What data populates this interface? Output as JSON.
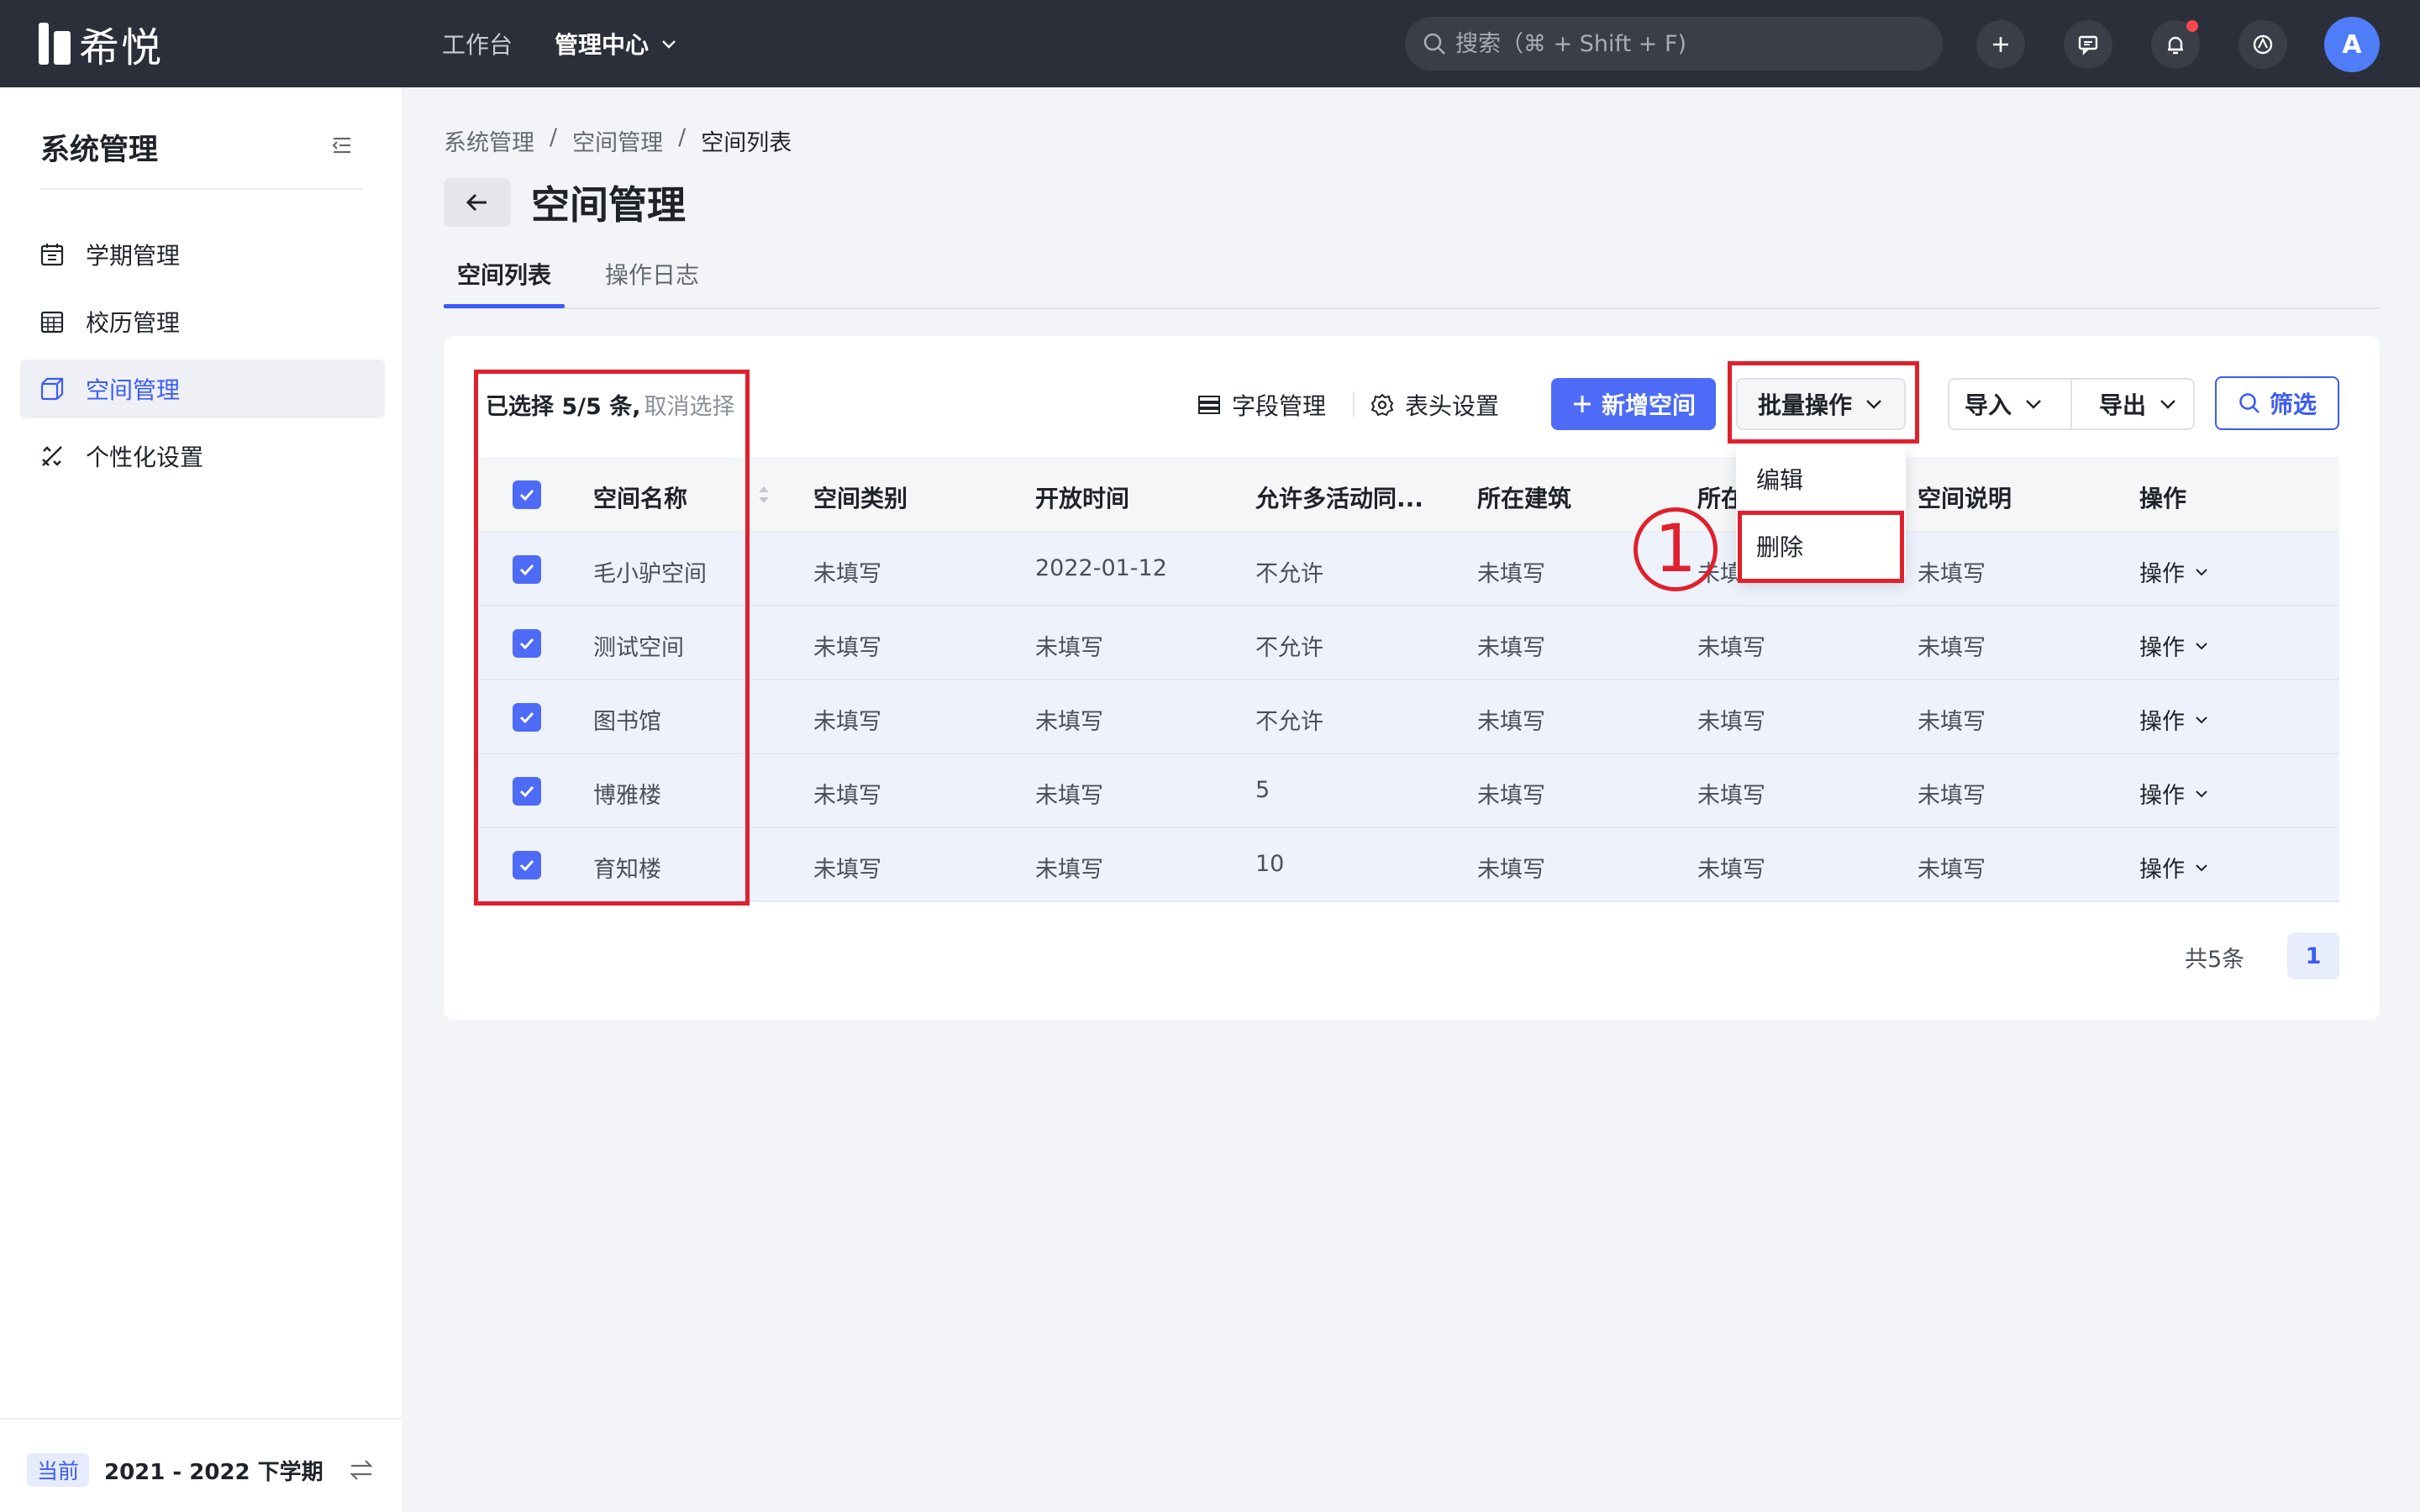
{
  "app": {
    "logo_text": "希悦",
    "nav": [
      "工作台",
      "管理中心"
    ],
    "search_placeholder": "搜索（⌘ + Shift + F)",
    "avatar_letter": "A"
  },
  "sidebar": {
    "title": "系统管理",
    "items": [
      {
        "label": "学期管理",
        "icon": "calendar-icon"
      },
      {
        "label": "校历管理",
        "icon": "school-calendar-icon"
      },
      {
        "label": "空间管理",
        "icon": "cube-icon",
        "active": true
      },
      {
        "label": "个性化设置",
        "icon": "tools-icon"
      }
    ],
    "footer": {
      "badge": "当前",
      "term": "2021 - 2022 下学期"
    }
  },
  "header": {
    "breadcrumb": [
      "系统管理",
      "空间管理",
      "空间列表"
    ],
    "title": "空间管理",
    "tabs": [
      "空间列表",
      "操作日志"
    ]
  },
  "toolbar": {
    "selection_text": "已选择 5/5 条,",
    "cancel_selection": "取消选择",
    "field_manage": "字段管理",
    "header_settings": "表头设置",
    "add_space": "新增空间",
    "batch_ops": "批量操作",
    "import": "导入",
    "export": "导出",
    "filter": "筛选"
  },
  "batch_menu": [
    "编辑",
    "删除"
  ],
  "table": {
    "columns": [
      "空间名称",
      "空间类别",
      "开放时间",
      "允许多活动同...",
      "所在建筑",
      "所在",
      "空间说明",
      "操作"
    ],
    "rows": [
      [
        "毛小驴空间",
        "未填写",
        "2022-01-12",
        "不允许",
        "未填写",
        "未填写",
        "未填写",
        "操作"
      ],
      [
        "测试空间",
        "未填写",
        "未填写",
        "不允许",
        "未填写",
        "未填写",
        "未填写",
        "操作"
      ],
      [
        "图书馆",
        "未填写",
        "未填写",
        "不允许",
        "未填写",
        "未填写",
        "未填写",
        "操作"
      ],
      [
        "博雅楼",
        "未填写",
        "未填写",
        "5",
        "未填写",
        "未填写",
        "未填写",
        "操作"
      ],
      [
        "育知楼",
        "未填写",
        "未填写",
        "10",
        "未填写",
        "未填写",
        "未填写",
        "操作"
      ]
    ]
  },
  "pagination": {
    "total": "共5条",
    "current": "1"
  },
  "annotation": {
    "step": "1"
  },
  "colors": {
    "primary": "#4d6bf7",
    "topbar": "#2b2f3a",
    "annotation": "#e0202c"
  }
}
